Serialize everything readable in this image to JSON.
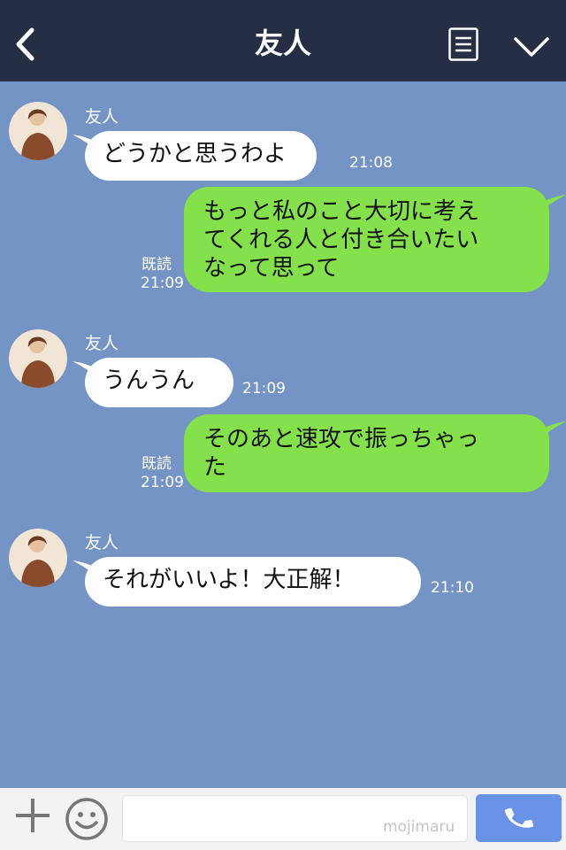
{
  "header": {
    "title": "友人"
  },
  "messages": [
    {
      "side": "in",
      "sender": "友人",
      "lines": [
        "どうかと思うわよ"
      ],
      "time": "21:08"
    },
    {
      "side": "out",
      "lines": [
        "もっと私のこと大切に考え",
        "てくれる人と付き合いたい",
        "なって思って"
      ],
      "read": "既読",
      "time": "21:09"
    },
    {
      "side": "in",
      "sender": "友人",
      "lines": [
        "うんうん"
      ],
      "time": "21:09"
    },
    {
      "side": "out",
      "lines": [
        "そのあと速攻で振っちゃっ",
        "た"
      ],
      "read": "既読",
      "time": "21:09"
    },
    {
      "side": "in",
      "sender": "友人",
      "lines": [
        "それがいいよ！大正解！"
      ],
      "time": "21:10"
    }
  ],
  "footer": {
    "watermark": "mojimaru",
    "input_value": ""
  },
  "colors": {
    "header": "#252e42",
    "background": "#7394c4",
    "outgoing": "#84e04b",
    "incoming": "#ffffff",
    "call": "#6a93e8"
  }
}
